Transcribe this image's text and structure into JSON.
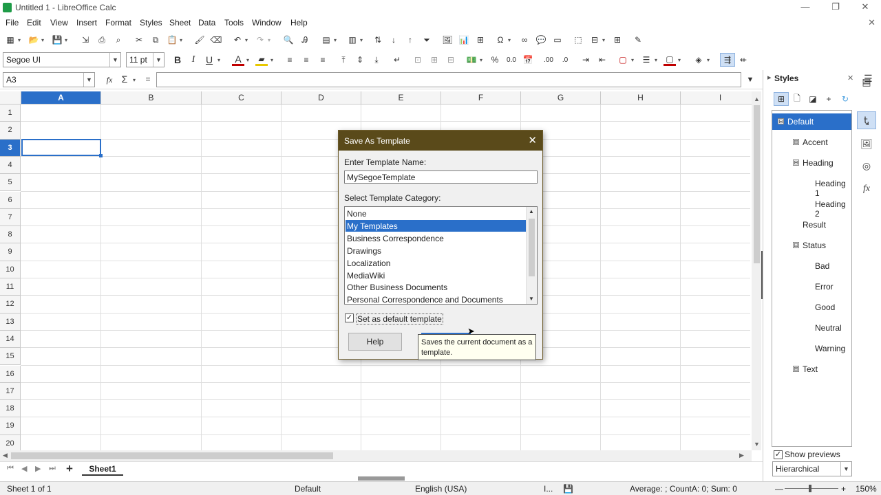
{
  "window": {
    "title": "Untitled 1 - LibreOffice Calc",
    "minimize": "—",
    "restore": "❐",
    "close": "✕"
  },
  "menu": [
    "File",
    "Edit",
    "View",
    "Insert",
    "Format",
    "Styles",
    "Sheet",
    "Data",
    "Tools",
    "Window",
    "Help"
  ],
  "formatting": {
    "font_name": "Segoe UI",
    "font_size": "11 pt"
  },
  "formula": {
    "name_box": "A3",
    "fx": "fx",
    "sigma": "Σ",
    "equals": "=",
    "value": ""
  },
  "columns": [
    "A",
    "B",
    "C",
    "D",
    "E",
    "F",
    "G",
    "H",
    "I"
  ],
  "rows": [
    "1",
    "2",
    "3",
    "4",
    "5",
    "6",
    "7",
    "8",
    "9",
    "10",
    "11",
    "12",
    "13",
    "14",
    "15",
    "16",
    "17",
    "18",
    "19",
    "20"
  ],
  "active_cell": {
    "column": "A",
    "row": "3"
  },
  "sheet_tabs": {
    "active": "Sheet1",
    "add": "+"
  },
  "status": {
    "sheet": "Sheet 1 of 1",
    "page_style": "Default",
    "language": "English (USA)",
    "selection_mode": "I...",
    "summary": "Average: ; CountA: 0; Sum: 0",
    "zoom": "150%",
    "zoom_minus": "—",
    "zoom_plus": "+"
  },
  "sidebar": {
    "title": "Styles",
    "tree": [
      {
        "label": "Default",
        "toggle": "⊟",
        "selected": true
      },
      {
        "label": "Accent",
        "toggle": "⊞"
      },
      {
        "label": "Heading",
        "toggle": "⊟"
      },
      {
        "label": "Heading 1"
      },
      {
        "label": "Heading 2"
      },
      {
        "label": "Result"
      },
      {
        "label": "Status",
        "toggle": "⊟"
      },
      {
        "label": "Bad"
      },
      {
        "label": "Error"
      },
      {
        "label": "Good"
      },
      {
        "label": "Neutral"
      },
      {
        "label": "Warning"
      },
      {
        "label": "Text",
        "toggle": "⊞"
      }
    ],
    "show_previews": "Show previews",
    "show_previews_checked": true,
    "filter": "Hierarchical"
  },
  "dialog": {
    "title": "Save As Template",
    "name_label": "Enter Template Name:",
    "name_value": "MySegoeTemplate",
    "category_label": "Select Template Category:",
    "categories": [
      "None",
      "My Templates",
      "Business Correspondence",
      "Drawings",
      "Localization",
      "MediaWiki",
      "Other Business Documents",
      "Personal Correspondence and Documents"
    ],
    "selected_category": "My Templates",
    "default_label": "Set as default template",
    "default_checked": true,
    "help_button": "Help",
    "check_mark": "✓"
  },
  "tooltip": {
    "text": "Saves the current document as a template."
  },
  "colors": {
    "accent": "#2a6fc9",
    "dialog_title": "#5a4a1a",
    "app_green": "#1e9b47"
  }
}
